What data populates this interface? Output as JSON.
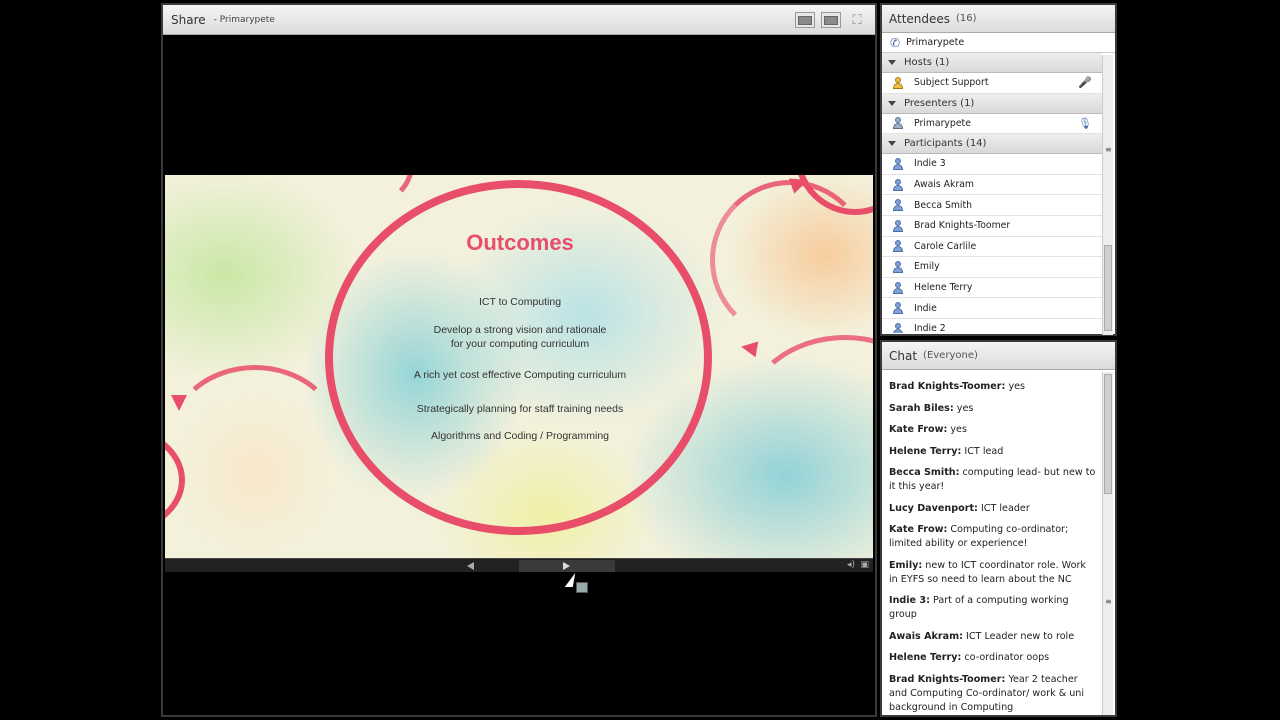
{
  "share_pod": {
    "title": "Share",
    "presenter": "- Primarypete",
    "slide": {
      "title": "Outcomes",
      "outcomes": [
        "ICT to Computing",
        "Develop a strong vision and rationale\nfor your computing curriculum",
        "A rich yet cost effective Computing curriculum",
        "Strategically planning for staff training needs",
        "Algorithms and Coding / Programming"
      ],
      "accent_color": "#e84e6a"
    }
  },
  "attendees_pod": {
    "title": "Attendees",
    "count": "(16)",
    "me": "Primarypete",
    "groups": [
      {
        "label": "Hosts (1)",
        "members": [
          {
            "name": "Subject Support",
            "role": "host",
            "status_icon": "mic-muted-icon"
          }
        ]
      },
      {
        "label": "Presenters (1)",
        "members": [
          {
            "name": "Primarypete",
            "role": "presenter",
            "status_icon": "mic-active-icon"
          }
        ]
      },
      {
        "label": "Participants (14)",
        "members": [
          {
            "name": "Indie 3",
            "role": "participant"
          },
          {
            "name": "Awais Akram",
            "role": "participant"
          },
          {
            "name": "Becca Smith",
            "role": "participant"
          },
          {
            "name": "Brad Knights-Toomer",
            "role": "participant"
          },
          {
            "name": "Carole Carlile",
            "role": "participant"
          },
          {
            "name": "Emily",
            "role": "participant"
          },
          {
            "name": "Helene Terry",
            "role": "participant"
          },
          {
            "name": "Indie",
            "role": "participant"
          },
          {
            "name": "Indie 2",
            "role": "participant"
          }
        ]
      }
    ]
  },
  "chat_pod": {
    "title": "Chat",
    "scope": "(Everyone)",
    "messages": [
      {
        "sender": "Brad Knights-Toomer:",
        "text": "yes"
      },
      {
        "sender": "Sarah Biles:",
        "text": "yes"
      },
      {
        "sender": "Kate Frow:",
        "text": "yes"
      },
      {
        "sender": "Helene Terry:",
        "text": "ICT lead"
      },
      {
        "sender": "Becca Smith:",
        "text": "computing lead- but new to it this year!"
      },
      {
        "sender": "Lucy Davenport:",
        "text": "ICT leader"
      },
      {
        "sender": "Kate Frow:",
        "text": "Computing co-ordinator; limited ability or experience!"
      },
      {
        "sender": "Emily:",
        "text": "new to ICT coordinator role. Work in EYFS so need to learn about the NC"
      },
      {
        "sender": "Indie 3:",
        "text": "Part of a computing working group"
      },
      {
        "sender": "Awais Akram:",
        "text": "ICT Leader new to role"
      },
      {
        "sender": "Helene Terry:",
        "text": "co-ordinator oops"
      },
      {
        "sender": "Brad Knights-Toomer:",
        "text": "Year 2 teacher and Computing Co-ordinator/ work & uni background in Computing"
      }
    ]
  }
}
